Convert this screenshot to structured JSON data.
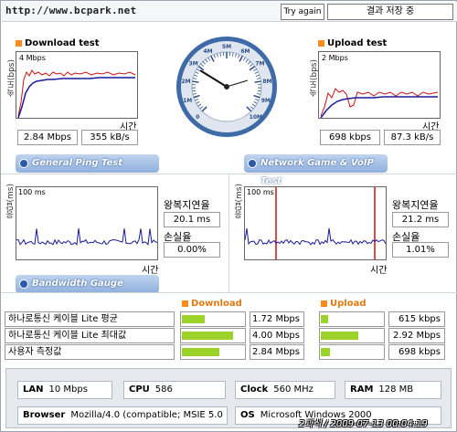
{
  "header": {
    "url_text": "http://www.bcpark.net",
    "try_again_label": "Try again",
    "save_status": "결과 저장 중"
  },
  "download": {
    "title": "Download test",
    "y_axis_label": "속도(bps)",
    "scale_label": "4 Mbps",
    "x_axis_label": "시간",
    "speed_mbps": "2.84 Mbps",
    "speed_kBs": "355 kB/s"
  },
  "upload": {
    "title": "Upload test",
    "y_axis_label": "속도(bps)",
    "scale_label": "2 Mbps",
    "x_axis_label": "시간",
    "speed_kbps": "698 kbps",
    "speed_kBs": "87.3 kB/s"
  },
  "gauge": {
    "tick_labels": [
      "0",
      "1M",
      "2M",
      "3M",
      "4M",
      "5M",
      "6M",
      "7M",
      "8M",
      "9M",
      "10M"
    ],
    "needle_value_mbps": 2.84
  },
  "ping": {
    "banner": "General Ping Test",
    "y_axis_label": "응답(ms)",
    "scale_label": "100 ms",
    "x_axis_label": "시간",
    "rtt_label": "왕복지연율",
    "rtt_value": "20.1 ms",
    "loss_label": "손실율",
    "loss_value": "0.00%"
  },
  "game": {
    "banner": "Network Game & VoIP Test",
    "y_axis_label": "응답(ms)",
    "scale_label": "100 ms",
    "x_axis_label": "시간",
    "rtt_label": "왕복지연율",
    "rtt_value": "21.2 ms",
    "loss_label": "손실율",
    "loss_value": "1.01%"
  },
  "bandwidth": {
    "banner": "Bandwidth Gauge",
    "download_header": "Download",
    "upload_header": "Upload",
    "rows": [
      {
        "label": "하나로통신 케이블 Lite 평균",
        "download": "1.72 Mbps",
        "download_fill": 0.35,
        "upload": "615 kbps",
        "upload_fill": 0.12
      },
      {
        "label": "하나로통신 케이블 Lite 최대값",
        "download": "4.00 Mbps",
        "download_fill": 0.8,
        "upload": "2.92 Mbps",
        "upload_fill": 0.58
      },
      {
        "label": "사용자 측정값",
        "download": "2.84 Mbps",
        "download_fill": 0.58,
        "upload": "698 kbps",
        "upload_fill": 0.14
      }
    ]
  },
  "system": {
    "lan_label": "LAN",
    "lan_value": "10 Mbps",
    "cpu_label": "CPU",
    "cpu_value": "586",
    "clock_label": "Clock",
    "clock_value": "560 MHz",
    "ram_label": "RAM",
    "ram_value": "128 MB",
    "browser_label": "Browser",
    "browser_value": "Mozilla/4.0 (compatible; MSIE 5.0",
    "os_label": "OS",
    "os_value": "Microsoft Windows 2000"
  },
  "footer": {
    "timestamp": "2과석 / 2009-07-13 00:04:19"
  },
  "colors": {
    "accent_orange": "#ff8a1e",
    "bar_green": "#9bd32a",
    "banner_blue": "#8fb0de",
    "trace_blue": "#1a1a9a",
    "trace_red": "#cc1010"
  }
}
